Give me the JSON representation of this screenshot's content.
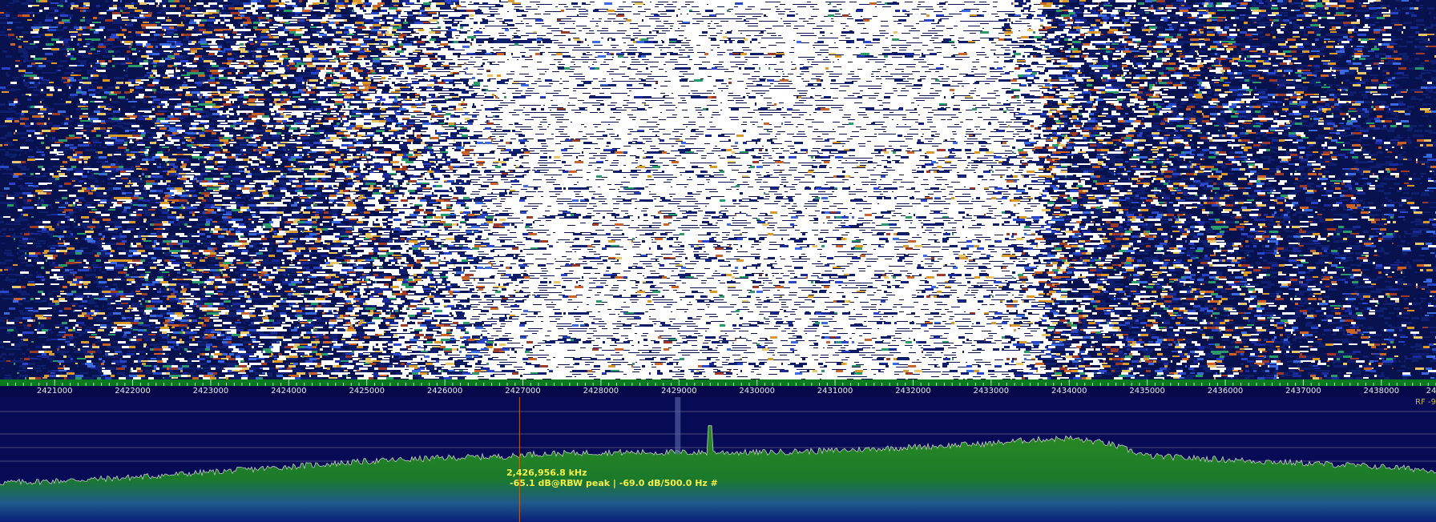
{
  "waterfall": {
    "description_colors": {
      "background": "#07114d",
      "hot": "#ffffff"
    }
  },
  "frequency_axis": {
    "unit": "kHz",
    "ticks": [
      "2421000",
      "2422000",
      "2423000",
      "2424000",
      "2425000",
      "2426000",
      "2427000",
      "2428000",
      "2429000",
      "2430000",
      "2431000",
      "2432000",
      "2433000",
      "2434000",
      "2435000",
      "2436000",
      "2437000",
      "2438000",
      "24"
    ]
  },
  "spectrum": {
    "rf_label": "RF -9",
    "cursor": {
      "frequency_text": "2,426,956.8 kHz",
      "level_text": "-65.1 dB@RBW peak | -69.0 dB/500.0 Hz #"
    },
    "colors": {
      "background": "#070a54",
      "fill_top": "#2c8a20",
      "fill_bottom": "#0a1f7a",
      "trace": "#c8c8c8",
      "cursor": "#c86414",
      "readout": "#f4f04a"
    }
  },
  "chart_data": {
    "type": "area",
    "xlabel": "",
    "ylabel": "",
    "x_unit": "kHz",
    "xlim": [
      2420300,
      2438700
    ],
    "ylim": [
      -110,
      -40
    ],
    "x": [
      2420300,
      2421000,
      2422000,
      2423000,
      2424000,
      2425000,
      2426000,
      2426957,
      2427000,
      2428000,
      2429000,
      2429400,
      2430000,
      2431000,
      2432000,
      2433000,
      2433500,
      2434000,
      2434500,
      2435000,
      2436000,
      2437000,
      2438000,
      2438700
    ],
    "values": [
      -88,
      -87,
      -85,
      -82,
      -79,
      -76,
      -74,
      -73,
      -72,
      -71,
      -71,
      -56,
      -71,
      -70,
      -68,
      -66,
      -64,
      -63,
      -66,
      -73,
      -75,
      -77,
      -79,
      -81
    ]
  }
}
